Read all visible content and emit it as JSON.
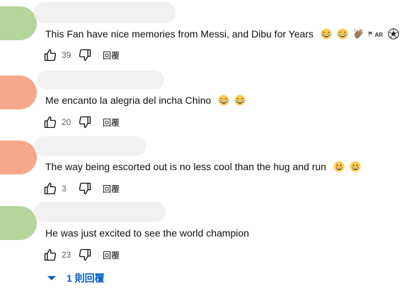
{
  "colors": {
    "avatar_green": "#b5d59a",
    "avatar_salmon": "#f5a88c",
    "link_blue": "#065fd4",
    "muted_text": "#606060"
  },
  "comments": [
    {
      "text": "This Fan have nice memories from Messi, and Dibu for Years",
      "emojis": [
        "face-with-tears-of-joy",
        "face-with-tears-of-joy",
        "clapping-hands",
        "argentina-flag",
        "soccer-ball"
      ],
      "flag_label": "AR",
      "likes": "39",
      "reply_label": "回覆",
      "avatar_color": "green"
    },
    {
      "text": "Me encanto la alegria del incha Chino",
      "emojis": [
        "face-with-tears-of-joy",
        "face-with-tears-of-joy"
      ],
      "likes": "20",
      "reply_label": "回覆",
      "avatar_color": "salmon"
    },
    {
      "text": "The way being escorted out is no less cool than the hug and run",
      "emojis": [
        "grinning-face",
        "grinning-face"
      ],
      "likes": "3",
      "reply_label": "回覆",
      "avatar_color": "salmon"
    },
    {
      "text": "He was just excited to see the world champion",
      "emojis": [],
      "likes": "23",
      "reply_label": "回覆",
      "avatar_color": "green"
    }
  ],
  "replies_toggle": {
    "label": "1 則回覆",
    "icon": "chevron-down-icon"
  }
}
